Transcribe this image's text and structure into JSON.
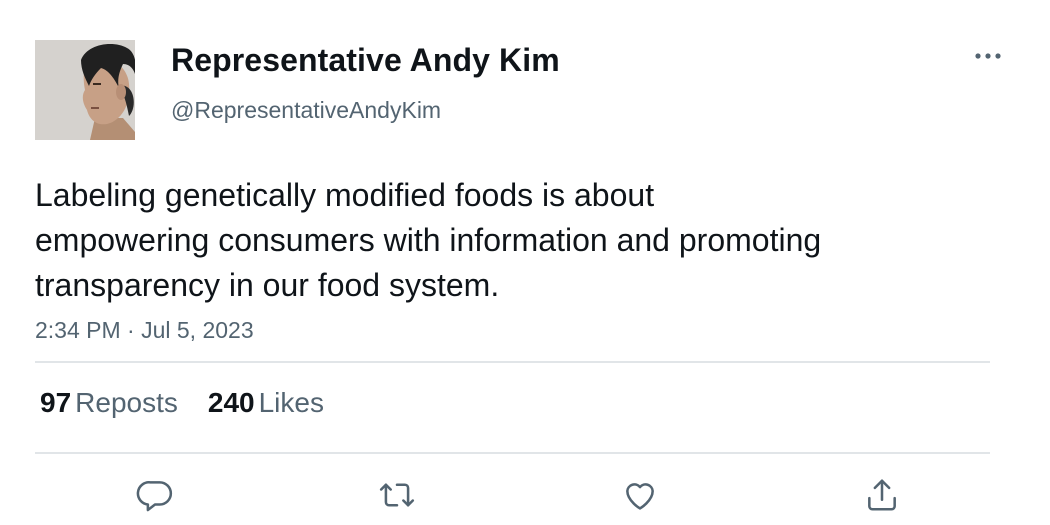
{
  "author": {
    "name": "Representative Andy Kim",
    "handle": "@RepresentativeAndyKim",
    "avatar_icon": "profile-photo"
  },
  "post": {
    "lines": [
      "Labeling genetically modified foods is about",
      "empowering consumers with information and promoting",
      "transparency in our food system."
    ],
    "timestamp": "2:34 PM · Jul 5, 2023"
  },
  "stats": {
    "reposts_count": "97",
    "reposts_label": "Reposts",
    "likes_count": "240",
    "likes_label": "Likes"
  },
  "actions": {
    "reply_icon": "reply-icon",
    "repost_icon": "repost-icon",
    "like_icon": "heart-icon",
    "share_icon": "share-icon"
  },
  "colors": {
    "text": "#0f1419",
    "secondary": "#536471",
    "divider": "#e1e5e8"
  }
}
